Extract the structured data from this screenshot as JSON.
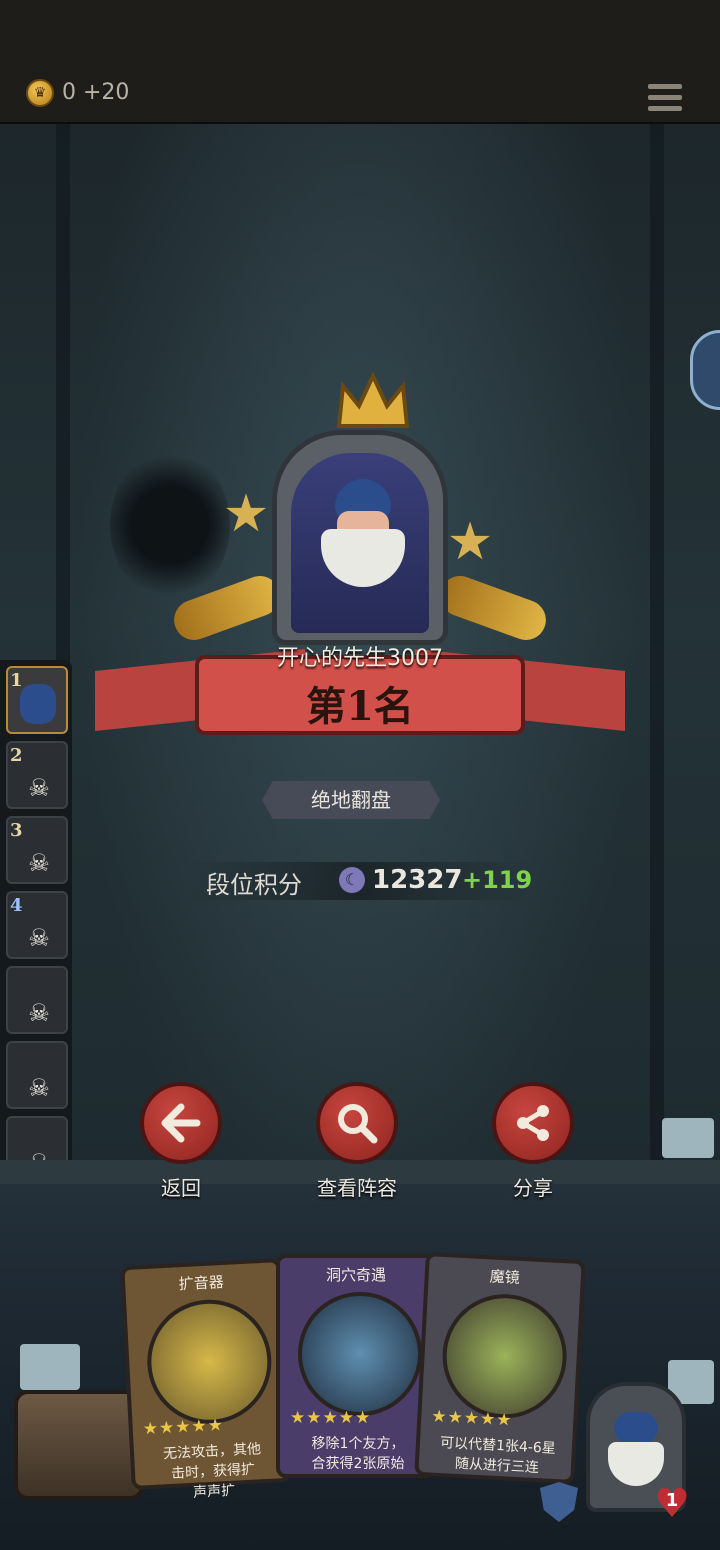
{
  "header": {
    "coins_text": "0 +20",
    "coin_icon": "crown-coin-icon",
    "menu_icon": "menu-icon"
  },
  "result": {
    "player_name": "开心的先生3007",
    "rank_label": "第1名",
    "title_tag": "绝地翻盘",
    "score_label": "段位积分",
    "score_value": "12327",
    "score_delta": "+119",
    "score_delta_color": "#7fd24b"
  },
  "ranking": [
    {
      "rank": "1",
      "state": "winner"
    },
    {
      "rank": "2",
      "state": "eliminated"
    },
    {
      "rank": "3",
      "state": "eliminated"
    },
    {
      "rank": "4",
      "state": "eliminated"
    },
    {
      "rank": "",
      "state": "eliminated"
    },
    {
      "rank": "",
      "state": "eliminated"
    },
    {
      "rank": "",
      "state": "eliminated"
    },
    {
      "rank": "",
      "state": "eliminated"
    }
  ],
  "actions": [
    {
      "label": "返回",
      "icon": "back-arrow-icon"
    },
    {
      "label": "查看阵容",
      "icon": "magnifier-icon"
    },
    {
      "label": "分享",
      "icon": "share-icon"
    }
  ],
  "cards": [
    {
      "title": "扩音器",
      "stars": "★★★★★",
      "text": "无法攻击，其他\n击时，获得扩\n声声扩"
    },
    {
      "title": "洞穴奇遇",
      "stars": "★★★★★",
      "text": "移除1个友方，\n合获得2张原始"
    },
    {
      "title": "魔镜",
      "stars": "★★★★★",
      "text": "可以代替1张4-6星\n随从进行三连"
    }
  ],
  "bottom": {
    "lives": "1"
  }
}
